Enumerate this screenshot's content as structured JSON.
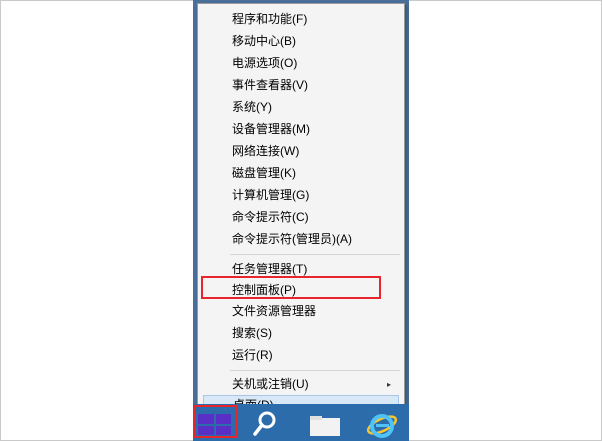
{
  "context_menu": {
    "items": [
      {
        "label": "程序和功能(F)"
      },
      {
        "label": "移动中心(B)"
      },
      {
        "label": "电源选项(O)"
      },
      {
        "label": "事件查看器(V)"
      },
      {
        "label": "系统(Y)"
      },
      {
        "label": "设备管理器(M)"
      },
      {
        "label": "网络连接(W)"
      },
      {
        "label": "磁盘管理(K)"
      },
      {
        "label": "计算机管理(G)"
      },
      {
        "label": "命令提示符(C)"
      },
      {
        "label": "命令提示符(管理员)(A)"
      },
      {
        "label": "任务管理器(T)"
      },
      {
        "label": "控制面板(P)"
      },
      {
        "label": "文件资源管理器"
      },
      {
        "label": "搜索(S)"
      },
      {
        "label": "运行(R)"
      },
      {
        "label": "关机或注销(U)"
      },
      {
        "label": "桌面(D)"
      }
    ],
    "submenu_arrow": "▸"
  },
  "taskbar": {
    "icons": [
      "windows-start-icon",
      "search-icon",
      "file-explorer-icon",
      "internet-explorer-icon"
    ]
  },
  "colors": {
    "highlight": "#e8242c",
    "taskbar": "#2d6cab",
    "start_logo": "#5a2fc8",
    "menu_bg": "#f4f4f4"
  }
}
